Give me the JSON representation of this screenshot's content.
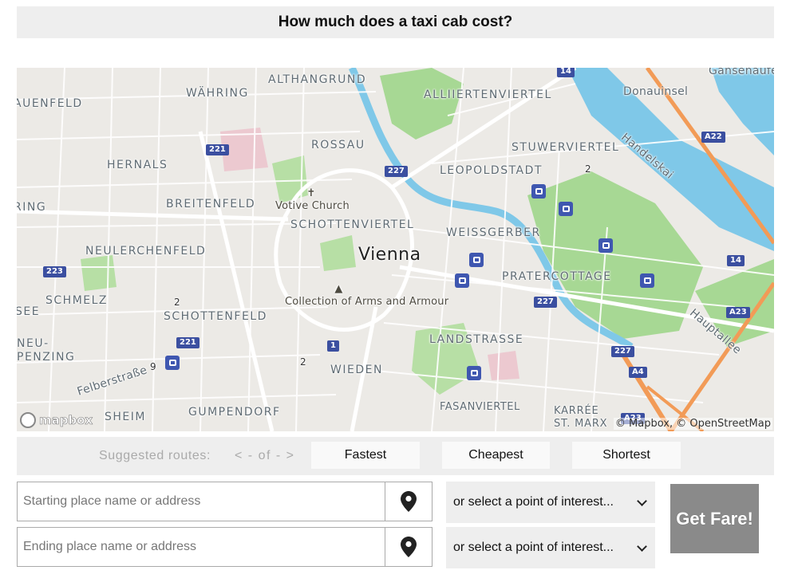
{
  "page": {
    "title": "How much does a taxi cab cost?"
  },
  "map": {
    "city_label": "Vienna",
    "district_labels": [
      "ALTHANGRUND",
      "WÄHRING",
      "AUENFELD",
      "ALLIIERTENVIERTEL",
      "Donauinsel",
      "Gänsehäufel",
      "ROSSAU",
      "HERNALS",
      "STUWERVIERTEL",
      "Handelskai",
      "LEOPOLDSTADT",
      "BREITENFELD",
      "RING",
      "SCHOTTENVIERTEL",
      "WEISSGERBER",
      "NEULERCHENFELD",
      "PRATERCOTTAGE",
      "SCHMELZ",
      "SEE",
      "SCHOTTENFELD",
      "NEU-PENZING",
      "LANDSTRASSE",
      "Hauptallee",
      "Felberstraße",
      "WIEDEN",
      "GUMPENDORF",
      "FASANVIERTEL",
      "KARRÉE ST. MARX",
      "SHEIM"
    ],
    "poi_labels": [
      "Votive Church",
      "Collection of Arms and Armour"
    ],
    "road_shields": [
      "14",
      "221",
      "227",
      "A22",
      "223",
      "14",
      "227",
      "A23",
      "221",
      "1",
      "227",
      "A4",
      "A23"
    ],
    "small_numbers": [
      "2",
      "2",
      "2",
      "9"
    ],
    "attribution": "© Mapbox, © OpenStreetMap",
    "logo_text": "mapbox",
    "colors": {
      "land": "#eceae6",
      "park": "#a7d894",
      "water": "#7fc8e8",
      "highway": "#f29b57",
      "road": "#ffffff",
      "shield": "#3b4fa0"
    }
  },
  "routes": {
    "label": "Suggested routes:",
    "nav": "< - of - >",
    "buttons": [
      "Fastest",
      "Cheapest",
      "Shortest"
    ]
  },
  "form": {
    "start_placeholder": "Starting place name or address",
    "end_placeholder": "Ending place name or address",
    "poi_select_text": "or select a point of interest...",
    "submit_label": "Get Fare!",
    "pin_icon": "map-pin-icon",
    "chevron_icon": "chevron-down-icon"
  }
}
